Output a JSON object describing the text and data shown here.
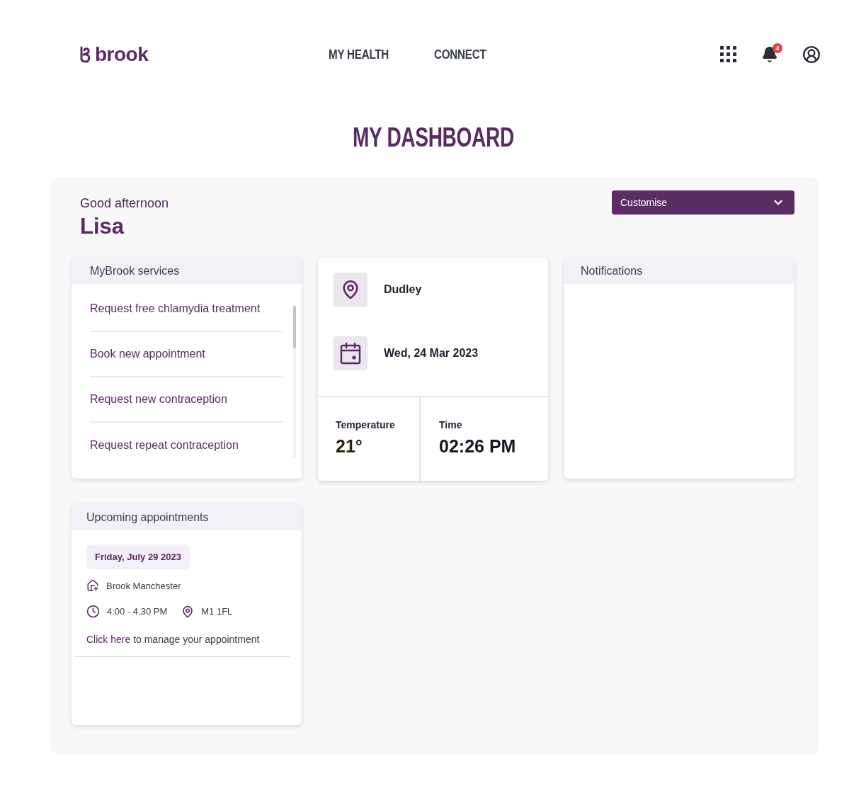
{
  "header": {
    "logo": "brook",
    "nav": [
      {
        "label": "MY HEALTH"
      },
      {
        "label": "CONNECT"
      }
    ],
    "notification_count": "4"
  },
  "page_title": "MY DASHBOARD",
  "greeting": {
    "salutation": "Good afternoon",
    "name": "Lisa"
  },
  "customise": {
    "label": "Customise"
  },
  "services": {
    "title": "MyBrook services",
    "items": [
      "Request free chlamydia treatment",
      "Book new appointment",
      "Request new contraception",
      "Request repeat contraception"
    ]
  },
  "info": {
    "location": "Dudley",
    "date": "Wed, 24 Mar 2023",
    "temperature": {
      "label": "Temperature",
      "value": "21°"
    },
    "time": {
      "label": "Time",
      "value": "02:26 PM"
    }
  },
  "notifications": {
    "title": "Notifications"
  },
  "appointments": {
    "title": "Upcoming appointments",
    "items": [
      {
        "date": "Friday, July 29 2023",
        "clinic": "Brook Manchester",
        "time": "4:00 - 4.30 PM",
        "postcode": "M1 1FL",
        "link": "Click here",
        "note": "to manage your appointment"
      }
    ]
  }
}
